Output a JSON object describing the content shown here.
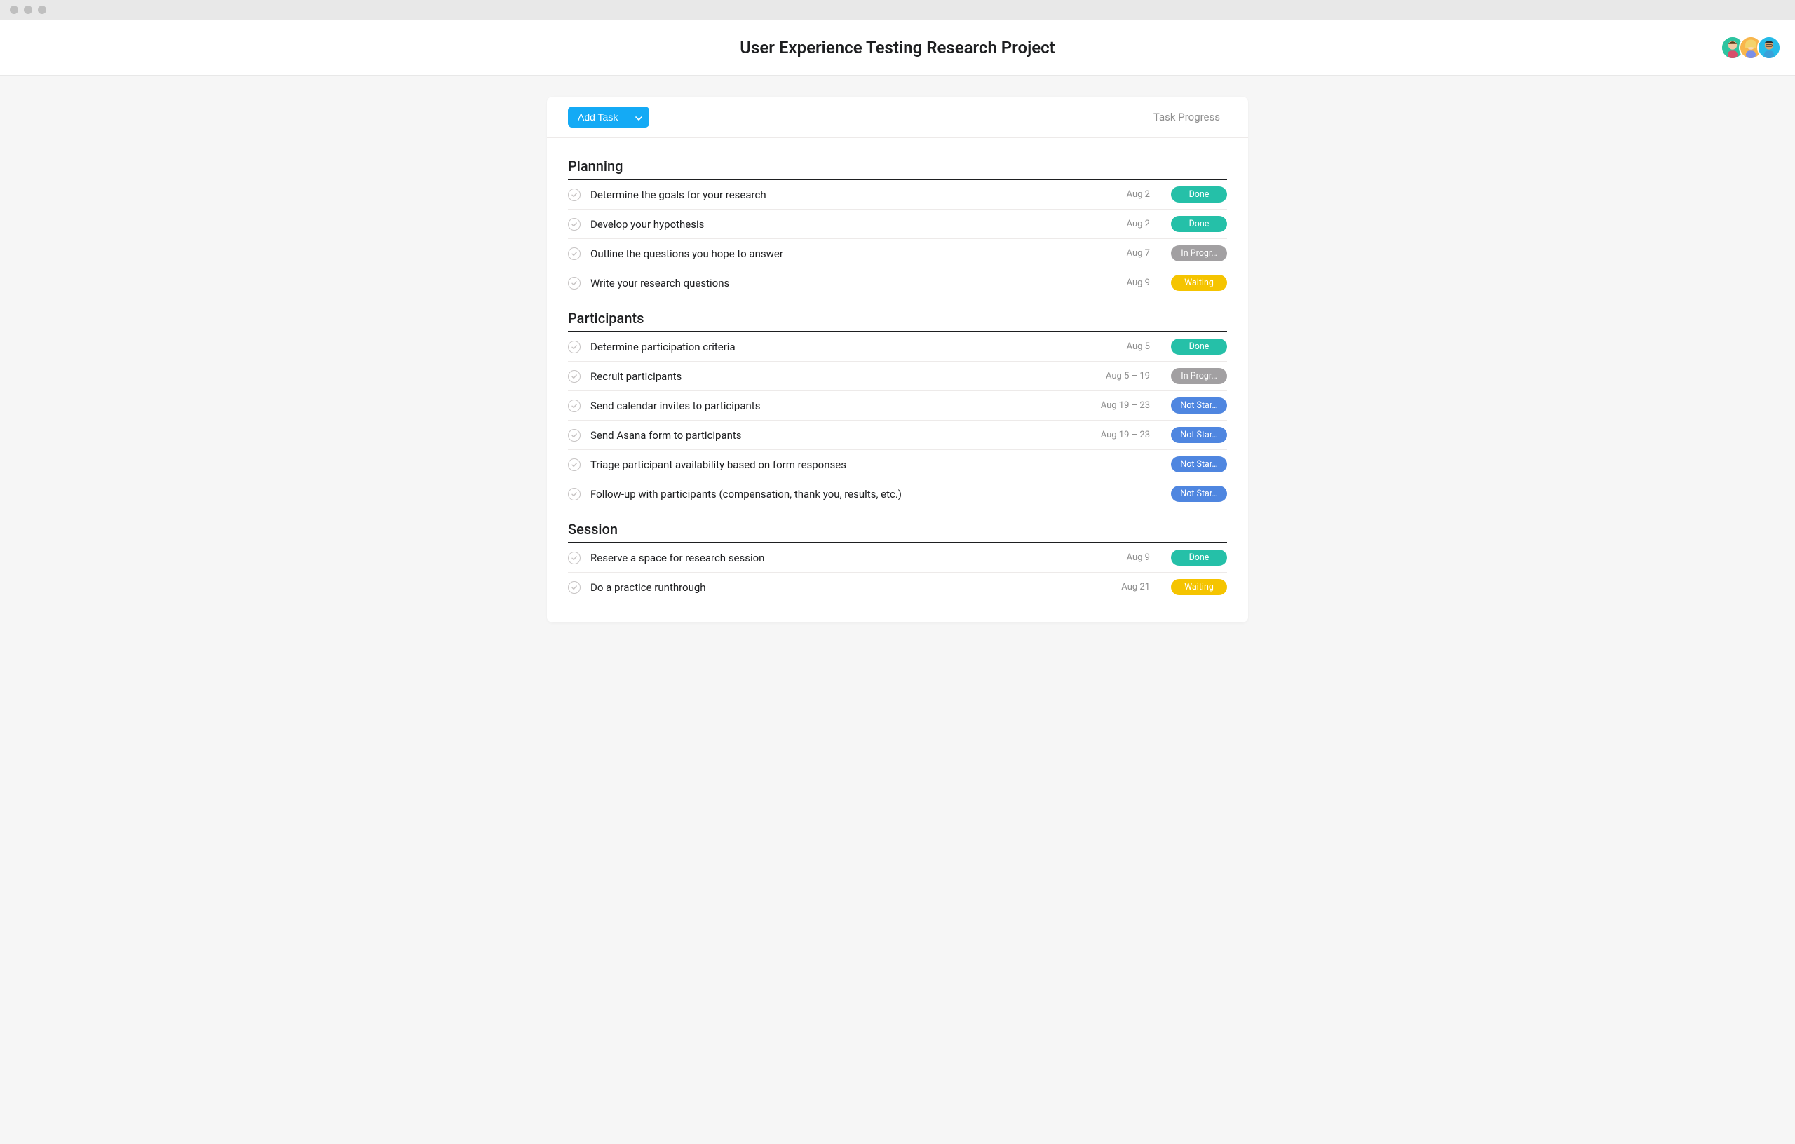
{
  "window": {
    "title": "User Experience Testing Research Project"
  },
  "header": {
    "add_task_label": "Add Task",
    "progress_col_label": "Task Progress"
  },
  "status_colors": {
    "Done": "#25c0a8",
    "In Progr…": "#a2a0a2",
    "Waiting": "#f5c400",
    "Not Star…": "#4f86e0"
  },
  "avatars": [
    {
      "bg": "#2ec4a0"
    },
    {
      "bg": "#f8b64c"
    },
    {
      "bg": "#26bbe8"
    }
  ],
  "sections": [
    {
      "title": "Planning",
      "tasks": [
        {
          "name": "Determine the goals for your research",
          "date": "Aug 2",
          "status": "Done"
        },
        {
          "name": "Develop your hypothesis",
          "date": "Aug 2",
          "status": "Done"
        },
        {
          "name": "Outline the questions you hope to answer",
          "date": "Aug 7",
          "status": "In Progr…"
        },
        {
          "name": "Write your research questions",
          "date": "Aug 9",
          "status": "Waiting"
        }
      ]
    },
    {
      "title": "Participants",
      "tasks": [
        {
          "name": "Determine participation criteria",
          "date": "Aug 5",
          "status": "Done"
        },
        {
          "name": "Recruit participants",
          "date": "Aug 5 – 19",
          "status": "In Progr…"
        },
        {
          "name": "Send calendar invites to participants",
          "date": "Aug 19 – 23",
          "status": "Not Star…"
        },
        {
          "name": "Send Asana form to participants",
          "date": "Aug 19 – 23",
          "status": "Not Star…"
        },
        {
          "name": "Triage participant availability based on form responses",
          "date": "",
          "status": "Not Star…"
        },
        {
          "name": "Follow-up with participants (compensation, thank you, results, etc.)",
          "date": "",
          "status": "Not Star…"
        }
      ]
    },
    {
      "title": "Session",
      "tasks": [
        {
          "name": "Reserve a space for research session",
          "date": "Aug 9",
          "status": "Done"
        },
        {
          "name": "Do a practice runthrough",
          "date": "Aug 21",
          "status": "Waiting"
        }
      ]
    }
  ]
}
